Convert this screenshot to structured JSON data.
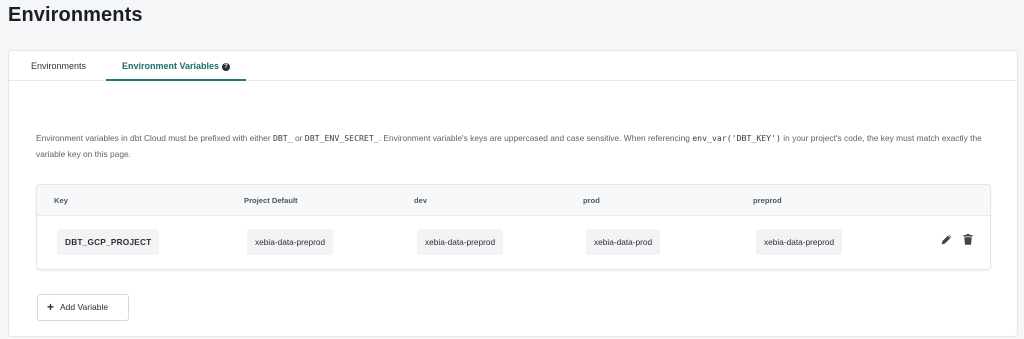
{
  "page": {
    "title": "Environments"
  },
  "tabs": [
    {
      "label": "Environments",
      "active": false
    },
    {
      "label": "Environment Variables",
      "active": true
    }
  ],
  "help_icon": "question-circle-icon",
  "description": {
    "part1": "Environment variables in dbt Cloud must be prefixed with either ",
    "code1": "DBT_",
    "part2": " or ",
    "code2": "DBT_ENV_SECRET_",
    "part3": ". Environment variable's keys are uppercased and case sensitive. When referencing ",
    "code3": "env_var('DBT_KEY')",
    "part4": " in your project's code, the key must match exactly the variable key on this page."
  },
  "table": {
    "columns": [
      "Key",
      "Project Default",
      "dev",
      "prod",
      "preprod"
    ],
    "rows": [
      {
        "key": "DBT_GCP_PROJECT",
        "project_default": "xebia-data-preprod",
        "dev": "xebia-data-preprod",
        "prod": "xebia-data-prod",
        "preprod": "xebia-data-preprod"
      }
    ]
  },
  "actions": {
    "edit_icon": "pencil-icon",
    "delete_icon": "trash-icon"
  },
  "add_button": {
    "label": "Add Variable",
    "icon": "plus-icon"
  },
  "colors": {
    "accent": "#1f7a74",
    "chip_bg": "#f2f3f5",
    "page_bg": "#f5f6f7"
  }
}
